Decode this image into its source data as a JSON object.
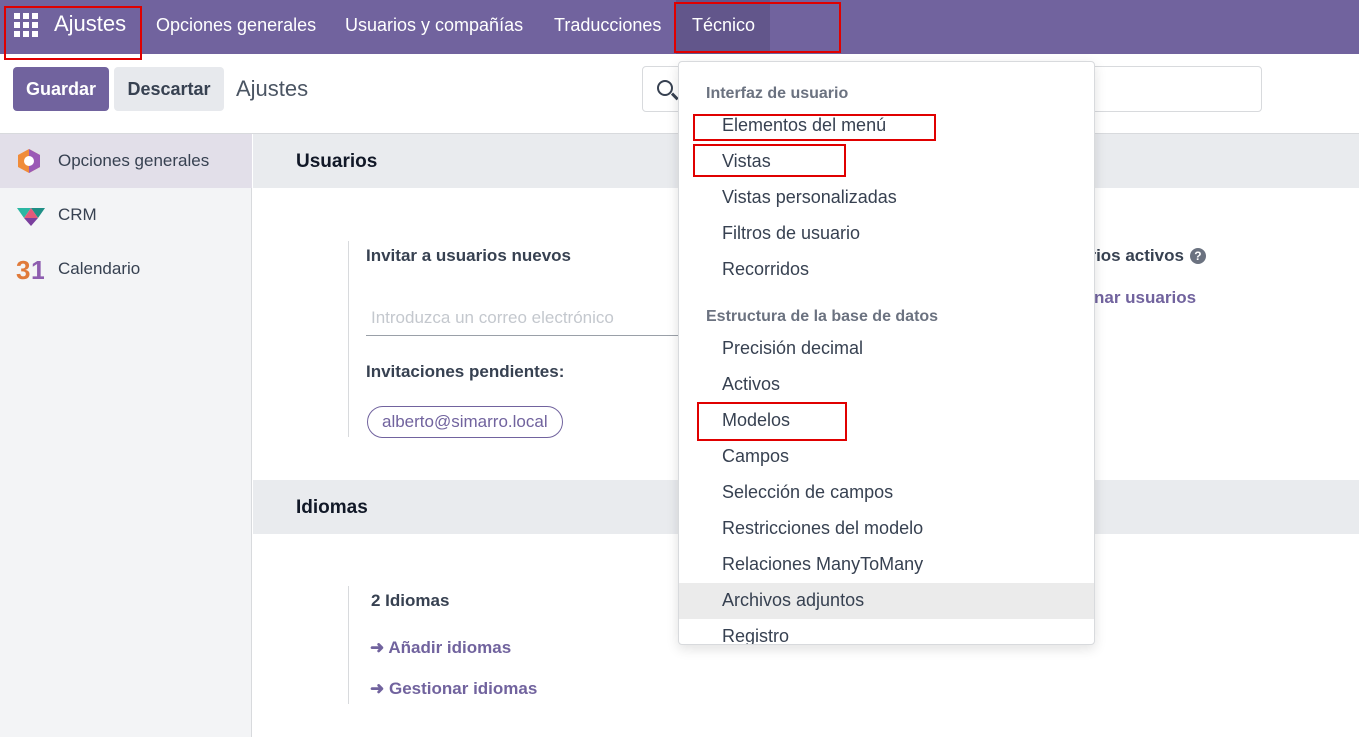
{
  "navbar": {
    "brand": "Ajustes",
    "menu": [
      "Opciones generales",
      "Usuarios y compañías",
      "Traducciones",
      "Técnico"
    ]
  },
  "control_panel": {
    "save_label": "Guardar",
    "discard_label": "Descartar",
    "title": "Ajustes"
  },
  "sidebar": {
    "items": [
      {
        "label": "Opciones generales",
        "icon": "settings-app-icon"
      },
      {
        "label": "CRM",
        "icon": "crm-app-icon"
      },
      {
        "label": "Calendario",
        "icon": "calendar-app-icon"
      }
    ]
  },
  "users_section": {
    "title": "Usuarios",
    "invite_label": "Invitar a usuarios nuevos",
    "email_placeholder": "Introduzca un correo electrónico",
    "pending_label": "Invitaciones pendientes:",
    "pending_email": "alberto@simarro.local",
    "active_users_partial": "arios activos",
    "manage_users_partial": "nar usuarios"
  },
  "languages_section": {
    "title": "Idiomas",
    "count_label": "2 Idiomas",
    "add_link": "Añadir idiomas",
    "manage_link": "Gestionar idiomas",
    "arrow": "➜"
  },
  "dropdown": {
    "group1_header": "Interfaz de usuario",
    "group1_items": [
      "Elementos del menú",
      "Vistas",
      "Vistas personalizadas",
      "Filtros de usuario",
      "Recorridos"
    ],
    "group2_header": "Estructura de la base de datos",
    "group2_items": [
      "Precisión decimal",
      "Activos",
      "Modelos",
      "Campos",
      "Selección de campos",
      "Restricciones del modelo",
      "Relaciones ManyToMany",
      "Archivos adjuntos",
      "Registro"
    ]
  },
  "colors": {
    "brand": "#71639e",
    "highlight_box": "#e00000"
  }
}
